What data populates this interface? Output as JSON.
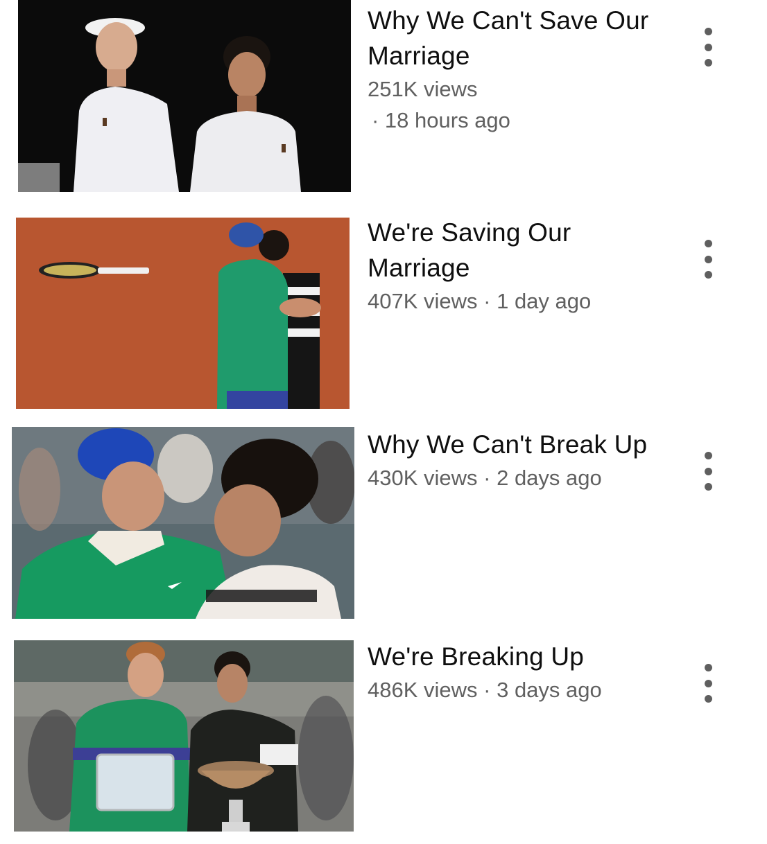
{
  "videos": [
    {
      "title": "Why We Can't Save Our Marriage",
      "views": "251K views",
      "age": "· 18 hours ago",
      "thumbnail": "two-tennis-players-portrait",
      "colors": {
        "bg": "#0c0c0c",
        "shirt": "#eeeeee"
      }
    },
    {
      "title": "We're Saving Our Marriage",
      "views": "407K views",
      "age": "· 1 day ago",
      "thumbnail": "players-hugging-on-clay",
      "colors": {
        "bg": "#b5502b",
        "shirt": "#1a9a6a"
      }
    },
    {
      "title": "Why We Can't Break Up",
      "views": "430K views",
      "age": "· 2 days ago",
      "thumbnail": "players-embracing-crowd",
      "colors": {
        "bg": "#5d6a6f",
        "shirt": "#16955f"
      }
    },
    {
      "title": "We're Breaking Up",
      "views": "486K views",
      "age": "· 3 days ago",
      "thumbnail": "players-with-trophies",
      "colors": {
        "bg": "#8e8f88",
        "shirt": "#1c8f5c"
      }
    }
  ]
}
